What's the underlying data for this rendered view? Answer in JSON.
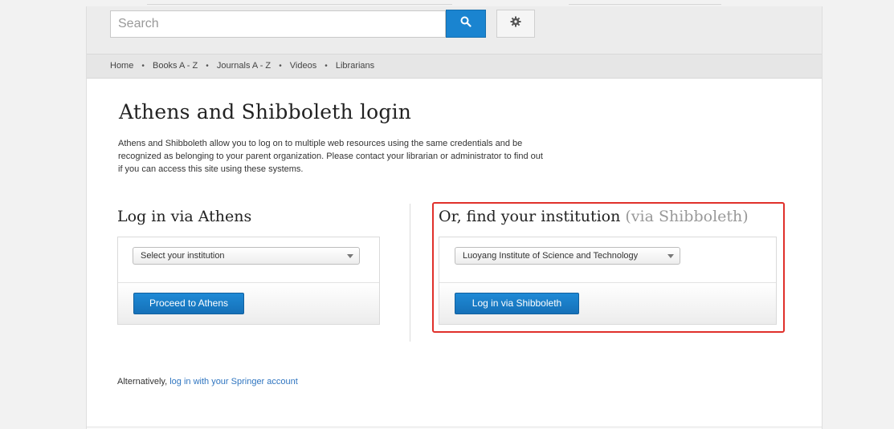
{
  "search": {
    "placeholder": "Search",
    "value": ""
  },
  "icons": {
    "search": "search-icon",
    "settings": "gear-icon",
    "dropdown": "chevron-down-icon"
  },
  "nav": {
    "items": [
      "Home",
      "Books A - Z",
      "Journals A - Z",
      "Videos",
      "Librarians"
    ],
    "separator": "•"
  },
  "page": {
    "title": "Athens and Shibboleth login",
    "intro": [
      "Athens and Shibboleth allow you to log on to multiple web resources using the same credentials and be",
      "recognized as belonging to your parent organization. Please contact your librarian or administrator to find out",
      "if you can access this site using these systems."
    ]
  },
  "athens": {
    "heading": "Log in via Athens",
    "select_value": "Select your institution",
    "button_label": "Proceed to Athens"
  },
  "shibboleth": {
    "heading": "Or, find your institution",
    "heading_suffix": "(via Shibboleth)",
    "select_value": "Luoyang Institute of Science and Technology",
    "button_label": "Log in via Shibboleth"
  },
  "alternative": {
    "prefix": "Alternatively,",
    "link": "log in with your Springer account"
  },
  "colors": {
    "accent": "#1a84d0",
    "link": "#2f75c0",
    "highlight": "#e0302b"
  }
}
